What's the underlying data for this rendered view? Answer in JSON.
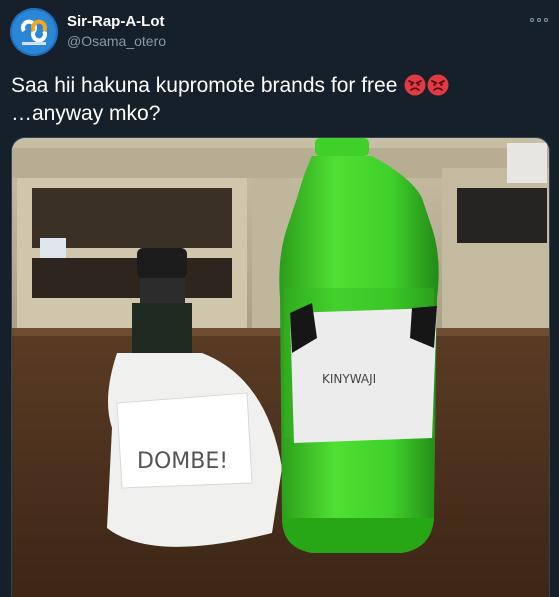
{
  "author": {
    "display_name": "Sir-Rap-A-Lot",
    "handle": "@Osama_otero",
    "avatar_icon": "infinity-logo-icon"
  },
  "tweet": {
    "text": "Saa hii hakuna kupromote brands for free",
    "emoji": [
      "angry-face-emoji",
      "angry-face-emoji"
    ],
    "text_line2": "…anyway mko?"
  },
  "photo": {
    "left_bottle_label": "DOMBE!",
    "right_bottle_label": "KINYWAJI"
  },
  "colors": {
    "background": "#15202b",
    "secondary_text": "#8899a6",
    "emoji_red": "#e03a44",
    "bottle_green": "#3fd02a"
  }
}
